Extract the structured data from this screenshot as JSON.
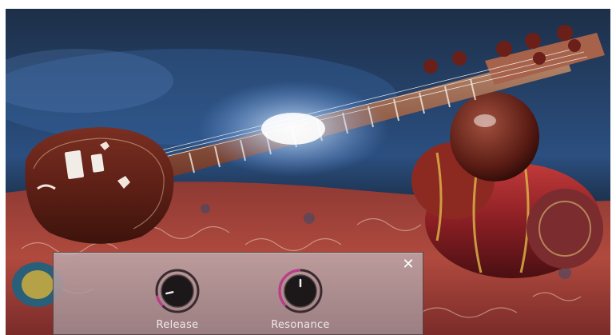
{
  "panel": {
    "close_glyph": "✕",
    "knobs": [
      {
        "label": "Release",
        "value": 0.12,
        "accent": "#c13a8c"
      },
      {
        "label": "Resonance",
        "value": 0.5,
        "accent": "#c13a8c"
      }
    ]
  },
  "scene": {
    "subject": "sitar-on-rug-background"
  }
}
